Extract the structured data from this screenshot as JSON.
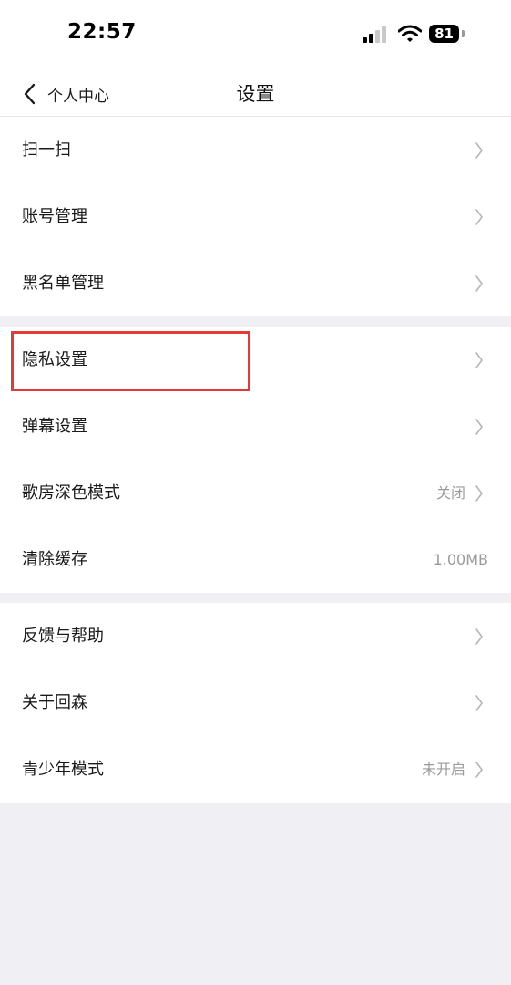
{
  "status_bar": {
    "time": "22:57",
    "battery": "81"
  },
  "nav": {
    "back_label": "个人中心",
    "title": "设置"
  },
  "groups": [
    {
      "items": [
        {
          "label": "扫一扫",
          "value": ""
        },
        {
          "label": "账号管理",
          "value": ""
        },
        {
          "label": "黑名单管理",
          "value": ""
        }
      ]
    },
    {
      "items": [
        {
          "label": "隐私设置",
          "value": ""
        },
        {
          "label": "弹幕设置",
          "value": ""
        },
        {
          "label": "歌房深色模式",
          "value": "关闭"
        },
        {
          "label": "清除缓存",
          "value": "1.00MB"
        }
      ]
    },
    {
      "items": [
        {
          "label": "反馈与帮助",
          "value": ""
        },
        {
          "label": "关于回森",
          "value": ""
        },
        {
          "label": "青少年模式",
          "value": "未开启"
        }
      ]
    }
  ],
  "colors": {
    "highlight": "#e53935",
    "background": "#efeff4",
    "secondary_text": "#9b9b9b"
  },
  "icons": {
    "back": "chevron-left-icon",
    "row_arrow": "chevron-right-icon",
    "signal": "cellular-signal-icon",
    "wifi": "wifi-icon",
    "battery": "battery-icon"
  }
}
